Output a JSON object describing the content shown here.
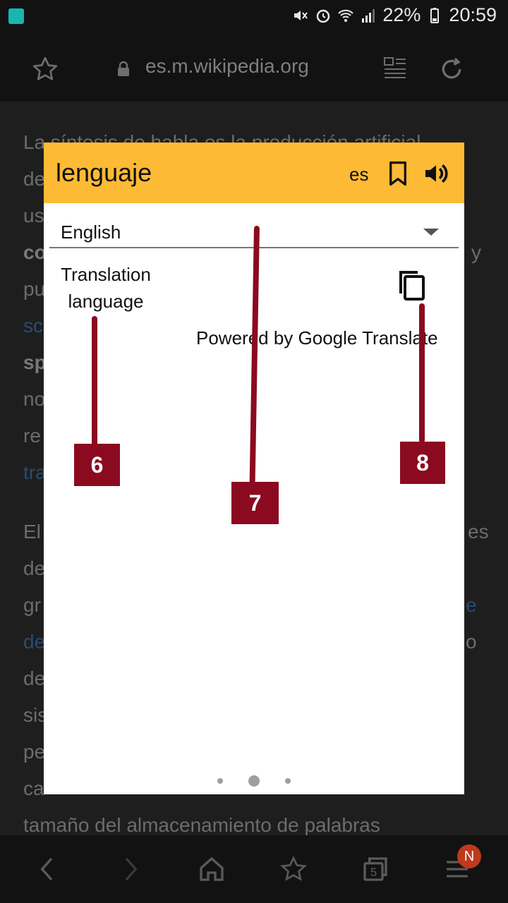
{
  "status_bar": {
    "battery": "22%",
    "time": "20:59"
  },
  "browser": {
    "url": "es.m.wikipedia.org"
  },
  "article": {
    "lines": [
      "La síntesis de habla es la producción artificial",
      "de",
      "us",
      "co",
      "pu",
      "sc",
      "sp",
      "no",
      "re",
      "tra",
      "El",
      "de",
      "gr",
      "de",
      "de",
      "sis",
      "pe",
      "ca",
      "tamaño del almacenamiento de palabras"
    ],
    "right_fragments": [
      "y",
      "es",
      "e",
      "o"
    ]
  },
  "dialog": {
    "word": "lenguaje",
    "source_lang": "es",
    "target_language": "English",
    "translation_label": "Translation language",
    "powered_by": "Powered by Google Translate",
    "pager": {
      "pages": 3,
      "current": 1
    }
  },
  "annotations": [
    "6",
    "7",
    "8"
  ],
  "bottom_nav": {
    "tabs_count": "5",
    "badge": "N"
  },
  "colors": {
    "header": "#fdba35",
    "annotation": "#8b0a1f"
  }
}
